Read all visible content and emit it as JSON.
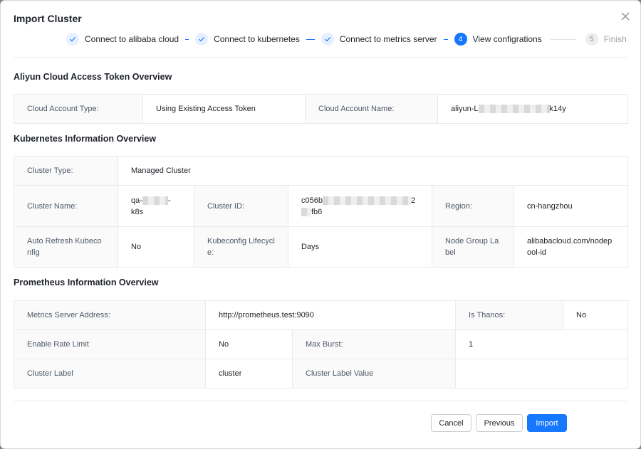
{
  "dialog": {
    "title": "Import Cluster"
  },
  "steps": [
    {
      "label": "Connect to alibaba cloud",
      "status": "done"
    },
    {
      "label": "Connect to kubernetes",
      "status": "done"
    },
    {
      "label": "Connect to metrics server",
      "status": "done"
    },
    {
      "label": "View configrations",
      "status": "active",
      "number": "4"
    },
    {
      "label": "Finish",
      "status": "pending",
      "number": "5"
    }
  ],
  "aliyun": {
    "title": "Aliyun Cloud Access Token Overview",
    "account_type_label": "Cloud Account Type:",
    "account_type_value": "Using Existing Access Token",
    "account_name_label": "Cloud Account Name:",
    "account_name_prefix": "aliyun-L",
    "account_name_suffix": "k14y"
  },
  "kubernetes": {
    "title": "Kubernetes Information Overview",
    "cluster_type_label": "Cluster Type:",
    "cluster_type_value": "Managed Cluster",
    "cluster_name_label": "Cluster Name:",
    "cluster_name_prefix": "qa-",
    "cluster_name_mid": "-",
    "cluster_name_suffix": "k8s",
    "cluster_id_label": "Cluster ID:",
    "cluster_id_prefix": "c056b",
    "cluster_id_mid": "2",
    "cluster_id_suffix": "fb6",
    "region_label": "Region:",
    "region_value": "cn-hangzhou",
    "auto_refresh_label": "Auto Refresh Kubeconfig",
    "auto_refresh_value": "No",
    "kubeconfig_lifecycle_label": "Kubeconfig Lifecycle:",
    "kubeconfig_lifecycle_value": "Days",
    "node_group_label": "Node Group Label",
    "node_group_value": "alibabacloud.com/nodepool-id"
  },
  "prometheus": {
    "title": "Prometheus Information Overview",
    "metrics_server_label": "Metrics Server Address:",
    "metrics_server_value": "http://prometheus.test:9090",
    "is_thanos_label": "Is Thanos:",
    "is_thanos_value": "No",
    "rate_limit_label": "Enable Rate Limit",
    "rate_limit_value": "No",
    "max_burst_label": "Max Burst:",
    "max_burst_value": "1",
    "cluster_label_label": "Cluster Label",
    "cluster_label_value": "cluster",
    "cluster_label_value_label": "Cluster Label Value",
    "cluster_label_value_value": ""
  },
  "footer": {
    "cancel_label": "Cancel",
    "previous_label": "Previous",
    "import_label": "Import"
  },
  "colors": {
    "primary": "#1677ff",
    "step_done_bg": "#e6f0ff"
  }
}
